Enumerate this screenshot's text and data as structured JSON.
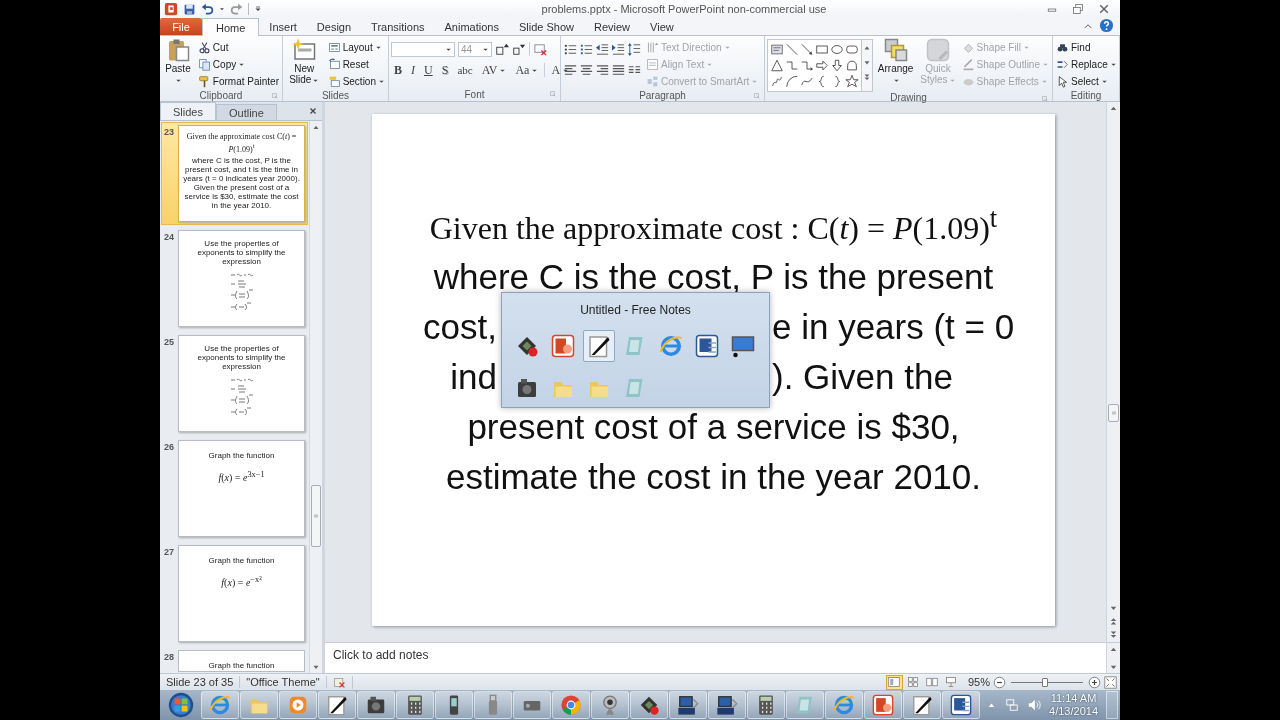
{
  "window": {
    "title": "problems.pptx  -  Microsoft PowerPoint non-commercial use"
  },
  "ribbon_tabs": [
    {
      "label": "File",
      "kind": "file",
      "selected": false
    },
    {
      "label": "Home",
      "kind": "tab",
      "selected": true
    },
    {
      "label": "Insert",
      "kind": "tab",
      "selected": false
    },
    {
      "label": "Design",
      "kind": "tab",
      "selected": false
    },
    {
      "label": "Transitions",
      "kind": "tab",
      "selected": false
    },
    {
      "label": "Animations",
      "kind": "tab",
      "selected": false
    },
    {
      "label": "Slide Show",
      "kind": "tab",
      "selected": false
    },
    {
      "label": "Review",
      "kind": "tab",
      "selected": false
    },
    {
      "label": "View",
      "kind": "tab",
      "selected": false
    }
  ],
  "ribbon_groups": [
    {
      "kind": "clipboard",
      "label": "Clipboard",
      "launcher": true,
      "big": [
        {
          "label": "Paste",
          "dropdown": true,
          "disabled": false
        }
      ],
      "items": [
        {
          "label": "Cut",
          "dropdown": false,
          "disabled": false
        },
        {
          "label": "Copy",
          "dropdown": true,
          "disabled": false
        },
        {
          "label": "Format Painter",
          "dropdown": false,
          "disabled": false
        }
      ]
    },
    {
      "kind": "slides",
      "label": "Slides",
      "launcher": false,
      "big": [
        {
          "label": "New Slide",
          "dropdown": true,
          "disabled": false
        }
      ],
      "items": [
        {
          "label": "Layout",
          "dropdown": true,
          "disabled": false
        },
        {
          "label": "Reset",
          "dropdown": false,
          "disabled": false
        },
        {
          "label": "Section",
          "dropdown": true,
          "disabled": false
        }
      ]
    },
    {
      "kind": "font",
      "label": "Font",
      "launcher": true,
      "font_size": "44",
      "buttons": [
        {
          "label": "B",
          "dropdown": false
        },
        {
          "label": "I",
          "dropdown": false
        },
        {
          "label": "U",
          "dropdown": false
        },
        {
          "label": "S",
          "dropdown": false
        },
        {
          "label": "abc",
          "dropdown": false
        },
        {
          "label": "AV",
          "dropdown": true
        },
        {
          "label": "Aa",
          "dropdown": true
        },
        {
          "label": "A",
          "dropdown": true
        }
      ]
    },
    {
      "kind": "paragraph",
      "label": "Paragraph",
      "launcher": true,
      "items": [
        {
          "label": "Text Direction",
          "dropdown": true,
          "disabled": true
        },
        {
          "label": "Align Text",
          "dropdown": true,
          "disabled": true
        },
        {
          "label": "Convert to SmartArt",
          "dropdown": true,
          "disabled": true
        }
      ]
    },
    {
      "kind": "drawing",
      "label": "Drawing",
      "launcher": true,
      "big": [
        {
          "label": "Arrange",
          "dropdown": true,
          "disabled": false
        },
        {
          "label": "Quick Styles",
          "dropdown": true,
          "disabled": true
        }
      ],
      "items": [
        {
          "label": "Shape Fill",
          "dropdown": true,
          "disabled": true
        },
        {
          "label": "Shape Outline",
          "dropdown": true,
          "disabled": true
        },
        {
          "label": "Shape Effects",
          "dropdown": true,
          "disabled": true
        }
      ]
    },
    {
      "kind": "editing",
      "label": "Editing",
      "launcher": false,
      "items": [
        {
          "label": "Find",
          "dropdown": false,
          "disabled": false
        },
        {
          "label": "Replace",
          "dropdown": true,
          "disabled": false
        },
        {
          "label": "Select",
          "dropdown": true,
          "disabled": false
        }
      ]
    }
  ],
  "pane_tabs": [
    {
      "label": "Slides",
      "selected": true
    },
    {
      "label": "Outline",
      "selected": false
    }
  ],
  "thumbnails": [
    {
      "number": "23",
      "selected": true,
      "kind": "text",
      "title": "Given the approximate cost C(*t*) = *P*(1.09)$^{t}$",
      "body": "where C is the cost, P is the present cost, and t is the time in years (t = 0 indicates year 2000).  Given the present cost of a service is $30, estimate the cost in the year 2010."
    },
    {
      "number": "24",
      "selected": false,
      "kind": "exercise",
      "title": "Use the properties  of exponents  to simplify the expression"
    },
    {
      "number": "25",
      "selected": false,
      "kind": "exercise",
      "title": "Use the properties  of exponents  to simplify the expression"
    },
    {
      "number": "26",
      "selected": false,
      "kind": "function",
      "title": "Graph the function",
      "formula": "*f*(*x*) = *e*$^{3x−1}$"
    },
    {
      "number": "27",
      "selected": false,
      "kind": "function",
      "title": "Graph the function",
      "formula": "*f*(*x*) = *e*$^{−x²}$"
    },
    {
      "number": "28",
      "selected": false,
      "kind": "partial",
      "title": "Graph the function"
    }
  ],
  "slide": {
    "title": "Given the approximate cost : C(*t*) = *P*(1.09)$^{t}$",
    "lines": [
      {
        "segments": [
          "where C is the cost, P is the present"
        ]
      },
      {
        "segments": [
          "cost,",
          "e in years (t = 0"
        ]
      },
      {
        "segments": [
          "ind",
          ").  Given the"
        ]
      },
      {
        "segments": [
          "present cost of a service is $30,"
        ]
      },
      {
        "segments": [
          "estimate the cost in the year 2010."
        ]
      }
    ]
  },
  "switcher": {
    "title": "Untitled - Free Notes",
    "items": [
      {
        "kind": "recorder",
        "selected": false
      },
      {
        "kind": "presentation",
        "selected": false
      },
      {
        "kind": "notes",
        "selected": true
      },
      {
        "kind": "notepad",
        "selected": false
      },
      {
        "kind": "browser",
        "selected": false
      },
      {
        "kind": "word",
        "selected": false
      },
      {
        "kind": "screen",
        "selected": false
      },
      {
        "kind": "camera",
        "selected": false
      },
      {
        "kind": "folder",
        "selected": false
      },
      {
        "kind": "folder",
        "selected": false
      },
      {
        "kind": "notepad",
        "selected": false
      }
    ]
  },
  "notes": {
    "prompt": "Click to add notes"
  },
  "status_bar": {
    "slide": "Slide 23 of 35",
    "theme": "\"Office Theme\"",
    "views": [
      {
        "selected": true
      },
      {
        "selected": false
      },
      {
        "selected": false
      },
      {
        "selected": false
      }
    ],
    "zoom": "95%",
    "level": 0.47
  },
  "taskbar": {
    "items": [
      {
        "kind": "start"
      },
      {
        "kind": "browser"
      },
      {
        "kind": "folder"
      },
      {
        "kind": "media"
      },
      {
        "kind": "notes"
      },
      {
        "kind": "camera"
      },
      {
        "kind": "calculator"
      },
      {
        "kind": "phone"
      },
      {
        "kind": "usb"
      },
      {
        "kind": "device"
      },
      {
        "kind": "chrome"
      },
      {
        "kind": "webcam"
      },
      {
        "kind": "recorder"
      },
      {
        "kind": "computer"
      },
      {
        "kind": "computer"
      },
      {
        "kind": "calculator"
      },
      {
        "kind": "notepad"
      },
      {
        "kind": "browser"
      },
      {
        "kind": "presentation"
      },
      {
        "kind": "notes"
      },
      {
        "kind": "word"
      }
    ],
    "time": "11:14 AM",
    "date": "4/13/2014"
  }
}
